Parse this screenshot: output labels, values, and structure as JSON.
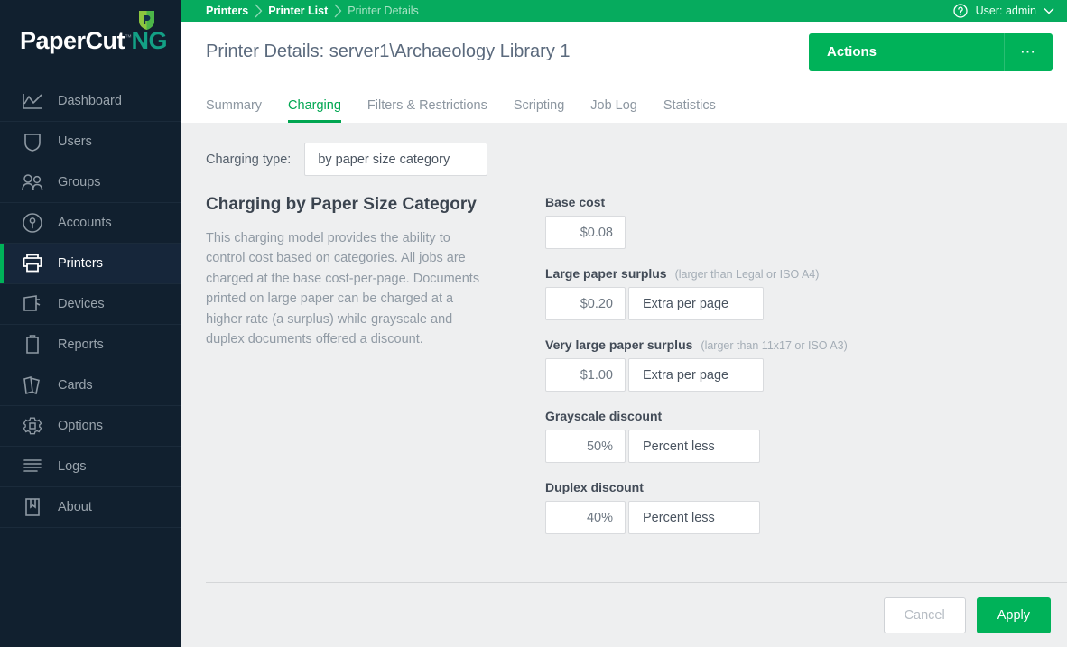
{
  "brand": {
    "name_main": "PaperCut",
    "name_suffix": "NG",
    "trademark": "™",
    "leaf_color": "#8dc63f",
    "leaf_accent": "#00a651"
  },
  "sidebar": {
    "items": [
      {
        "label": "Dashboard",
        "icon": "chart-line-icon",
        "active": false
      },
      {
        "label": "Users",
        "icon": "shield-user-icon",
        "active": false
      },
      {
        "label": "Groups",
        "icon": "people-group-icon",
        "active": false
      },
      {
        "label": "Accounts",
        "icon": "key-circle-icon",
        "active": false
      },
      {
        "label": "Printers",
        "icon": "printer-icon",
        "active": true
      },
      {
        "label": "Devices",
        "icon": "device-icon",
        "active": false
      },
      {
        "label": "Reports",
        "icon": "clipboard-icon",
        "active": false
      },
      {
        "label": "Cards",
        "icon": "cards-icon",
        "active": false
      },
      {
        "label": "Options",
        "icon": "gear-icon",
        "active": false
      },
      {
        "label": "Logs",
        "icon": "lines-icon",
        "active": false
      },
      {
        "label": "About",
        "icon": "bookmark-book-icon",
        "active": false
      }
    ]
  },
  "topbar": {
    "breadcrumbs": [
      {
        "label": "Printers",
        "muted": false
      },
      {
        "label": "Printer List",
        "muted": false
      },
      {
        "label": "Printer Details",
        "muted": true
      }
    ],
    "help_icon": "help-circle-icon",
    "user_label": "User: admin",
    "caret_icon": "chevron-down-icon",
    "background": "#06ab5e"
  },
  "header": {
    "title": "Printer Details: server1\\Archaeology Library 1",
    "actions_label": "Actions",
    "actions_menu_icon": "ellipsis-icon",
    "actions_color": "#00b259"
  },
  "tabs": [
    {
      "label": "Summary",
      "active": false
    },
    {
      "label": "Charging",
      "active": true
    },
    {
      "label": "Filters & Restrictions",
      "active": false
    },
    {
      "label": "Scripting",
      "active": false
    },
    {
      "label": "Job Log",
      "active": false
    },
    {
      "label": "Statistics",
      "active": false
    }
  ],
  "charging": {
    "type_label": "Charging type:",
    "type_value": "by paper size category",
    "section_title": "Charging by Paper Size Category",
    "section_description": "This charging model provides the ability to control cost based on categories. All jobs are charged at the base cost-per-page. Documents printed on large paper can be charged at a higher rate (a surplus) while grayscale and duplex documents offered a discount.",
    "fields": [
      {
        "label": "Base cost",
        "hint": "",
        "value": "$0.08",
        "unit": ""
      },
      {
        "label": "Large paper surplus",
        "hint": "(larger than Legal or ISO A4)",
        "value": "$0.20",
        "unit": "Extra per page"
      },
      {
        "label": "Very large paper surplus",
        "hint": "(larger than 11x17 or ISO A3)",
        "value": "$1.00",
        "unit": "Extra per page"
      },
      {
        "label": "Grayscale discount",
        "hint": "",
        "value": "50%",
        "unit": "Percent less"
      },
      {
        "label": "Duplex discount",
        "hint": "",
        "value": "40%",
        "unit": "Percent less"
      }
    ]
  },
  "footer": {
    "cancel_label": "Cancel",
    "apply_label": "Apply",
    "apply_color": "#00b259"
  }
}
